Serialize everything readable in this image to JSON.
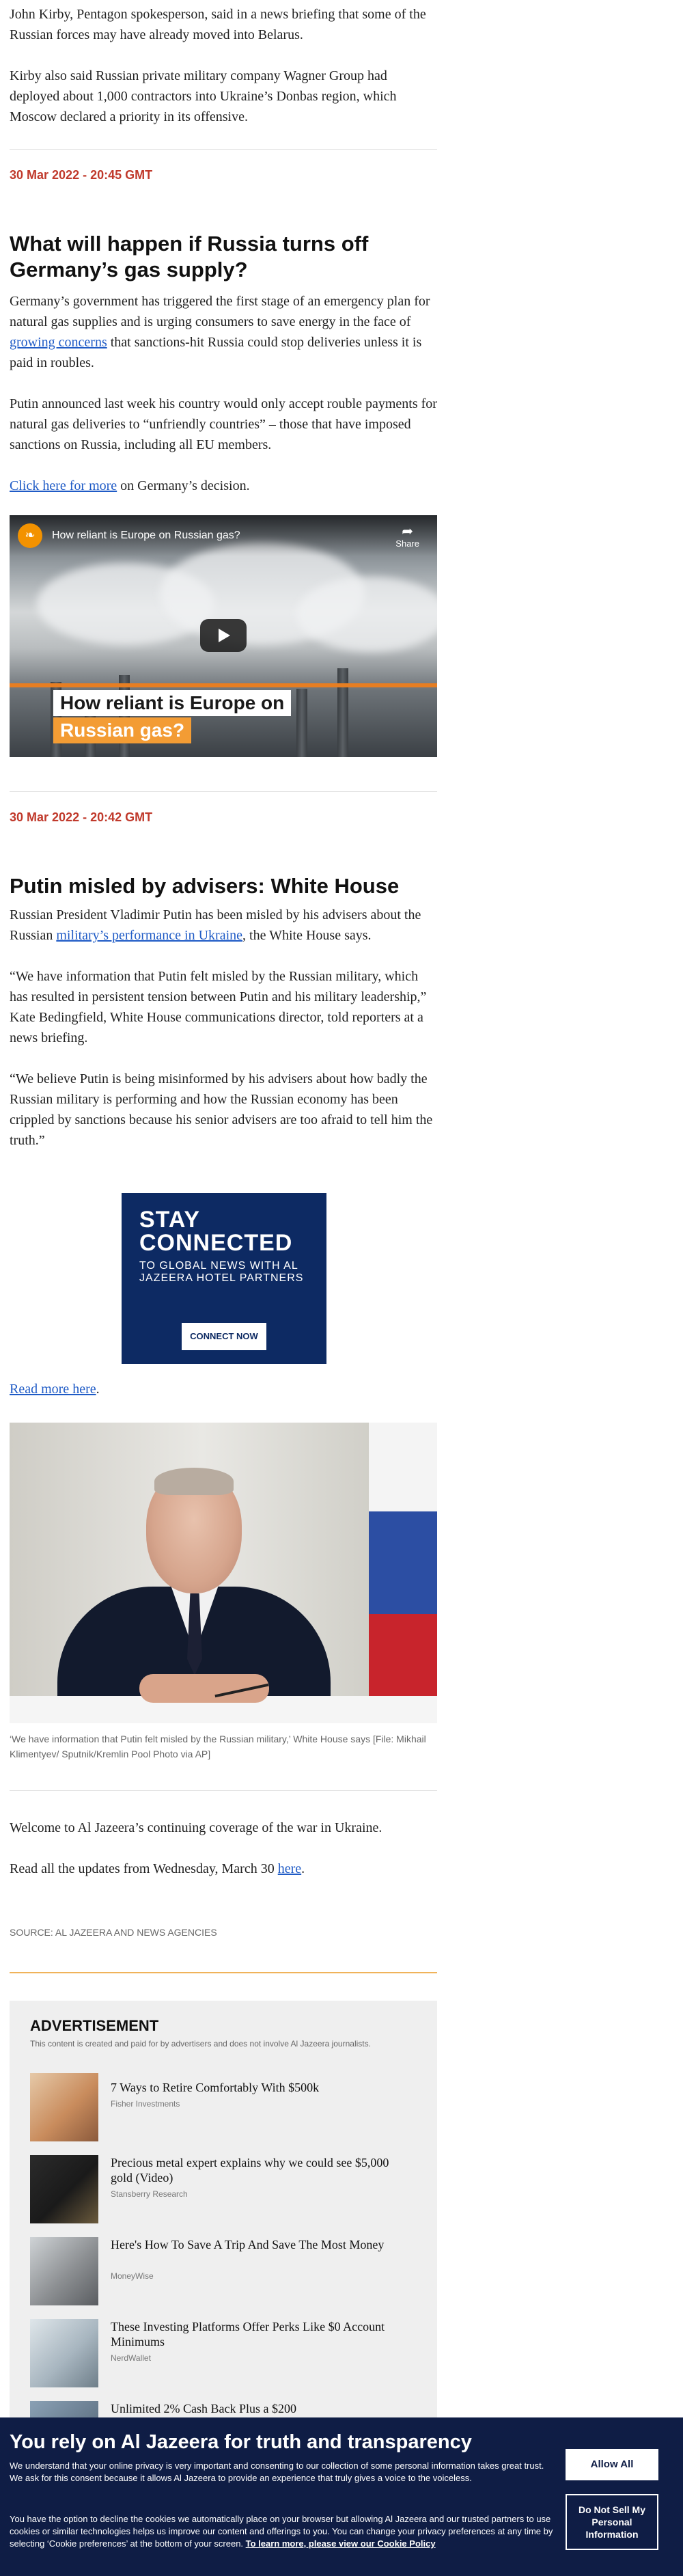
{
  "top_paragraphs": [
    "John Kirby, Pentagon spokesperson, said in a news briefing that some of the Russian forces may have already moved into Belarus.",
    "Kirby also said Russian private military company Wagner Group had deployed about 1,000 contractors into Ukraine’s Donbas region, which Moscow declared a priority in its offensive."
  ],
  "post1": {
    "timestamp": "30 Mar 2022 - 20:45 GMT",
    "headline": "What will happen if Russia turns off Germany’s gas supply?",
    "p1_before": "Germany’s government has triggered the first stage of an emergency plan for natural gas supplies and is urging consumers to save energy in the face of ",
    "p1_link": "growing concerns",
    "p1_after": " that sanctions-hit Russia could stop deliveries unless it is paid in roubles.",
    "p2": "Putin announced last week his country would only accept rouble payments for natural gas deliveries to “unfriendly countries” – those that have imposed sanctions on Russia, including all EU members.",
    "p3_link": "Click here for more",
    "p3_after": " on Germany’s decision.",
    "video": {
      "title": "How reliant is Europe on Russian gas?",
      "share_label": "Share",
      "caption_line1": "How reliant is Europe on",
      "caption_line2": "Russian gas?"
    }
  },
  "post2": {
    "timestamp": "30 Mar 2022 - 20:42 GMT",
    "headline": "Putin misled by advisers: White House",
    "p1_before": "Russian President Vladimir Putin has been misled by his advisers about the Russian ",
    "p1_link": "military’s performance in Ukraine",
    "p1_after": ", the White House says.",
    "p2": "“We have information that Putin felt misled by the Russian military, which has resulted in persistent tension between Putin and his military leadership,” Kate Bedingfield, White House communications director, told reporters at a news briefing.",
    "p3": "“We believe Putin is being misinformed by his advisers about how badly the Russian military is performing and how the Russian economy has been crippled by sanctions because his senior advisers are too afraid to tell him the truth.”",
    "ad": {
      "line1": "STAY",
      "line2": "CONNECTED",
      "line3": "TO GLOBAL NEWS WITH AL JAZEERA HOTEL PARTNERS",
      "button": "CONNECT NOW"
    },
    "read_more_link": "Read more here",
    "read_more_after": ".",
    "photo_caption": "‘We have information that Putin felt misled by the Russian military,’ White House says [File: Mikhail Klimentyev/ Sputnik/Kremlin Pool Photo via AP]"
  },
  "welcome": {
    "p1": "Welcome to Al Jazeera’s continuing coverage of the war in Ukraine.",
    "p2_before": "Read all the updates from Wednesday, March 30 ",
    "p2_link": "here",
    "p2_after": "."
  },
  "source": "SOURCE: AL JAZEERA AND NEWS AGENCIES",
  "advertisement": {
    "title": "ADVERTISEMENT",
    "note": "This content is created and paid for by advertisers and does not involve Al Jazeera journalists.",
    "items": [
      {
        "title": "7 Ways to Retire Comfortably With $500k",
        "source": "Fisher Investments"
      },
      {
        "title": "Precious metal expert explains why we could see $5,000 gold (Video)",
        "source": "Stansberry Research"
      },
      {
        "title": "Here's How To Save A Trip And Save The Most Money",
        "source": "MoneyWise"
      },
      {
        "title": "These Investing Platforms Offer Perks Like $0 Account Minimums",
        "source": "NerdWallet"
      },
      {
        "title": "Unlimited 2% Cash Back Plus a $200",
        "source": ""
      }
    ]
  },
  "cookie": {
    "heading": "You rely on Al Jazeera for truth and transparency",
    "text1": "We understand that your online privacy is very important and consenting to our collection of some personal information takes great trust. We ask for this consent because it allows Al Jazeera to provide an experience that truly gives a voice to the voiceless.",
    "text2": "You have the option to decline the cookies we automatically place on your browser but allowing Al Jazeera and our trusted partners to use cookies or similar technologies helps us improve our content and offerings to you. You can change your privacy preferences at any time by selecting ‘Cookie preferences’ at the bottom of your screen. ",
    "text2_link": "To learn more, please view our Cookie Policy",
    "allow_button": "Allow All",
    "dns_button": "Do Not Sell My Personal Information"
  }
}
